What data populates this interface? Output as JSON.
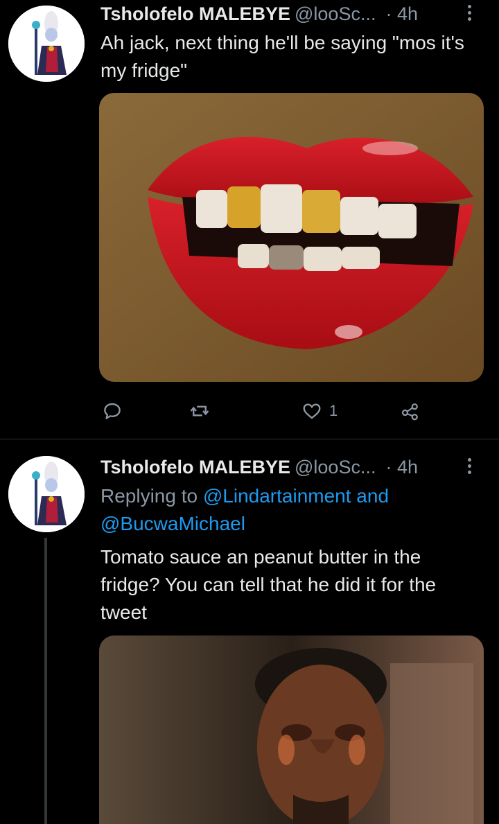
{
  "tweets": [
    {
      "author_name": "Tsholofelo MALEBYE",
      "handle": "@looSc...",
      "time": "· 4h",
      "text": "Ah jack, next thing he'll be saying \"mos it's my fridge\"",
      "actions": {
        "reply_count": "",
        "retweet_count": "",
        "like_count": "1"
      },
      "icons": [
        "reply-icon",
        "retweet-icon",
        "heart-icon",
        "share-icon",
        "more-icon"
      ]
    },
    {
      "author_name": "Tsholofelo MALEBYE",
      "handle": "@looSc...",
      "time": "· 4h",
      "replying_prefix": "Replying to ",
      "replying_mention1": "@Lindartainment",
      "replying_and": " and ",
      "replying_mention2": "@BucwaMichael",
      "text": "Tomato sauce an peanut butter in the fridge? You can tell that he did it for the tweet"
    }
  ],
  "colors": {
    "background": "#000000",
    "text": "#e7e9ea",
    "muted": "#8b98a5",
    "accent": "#1d9bf0"
  }
}
